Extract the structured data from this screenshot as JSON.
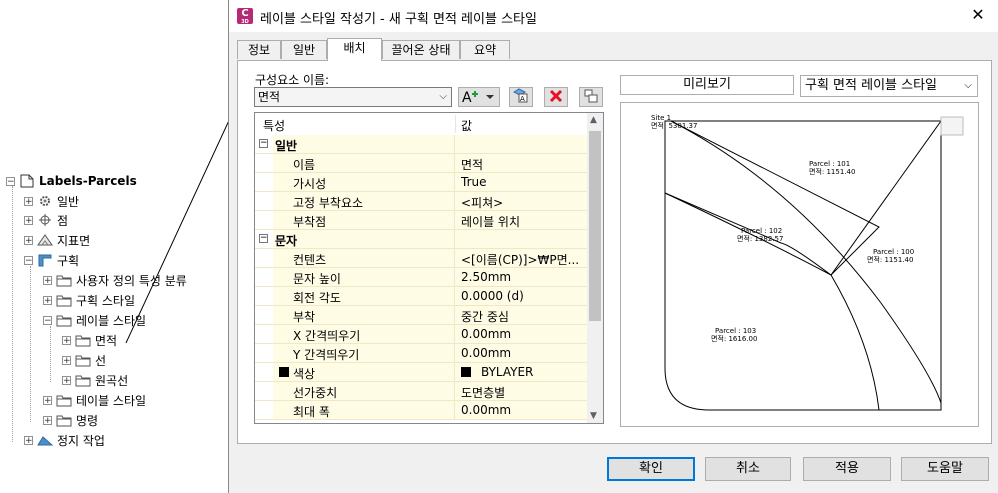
{
  "tree": {
    "root": "Labels-Parcels",
    "items": [
      {
        "label": "일반",
        "icon": "gear-icon"
      },
      {
        "label": "점",
        "icon": "point-icon"
      },
      {
        "label": "지표면",
        "icon": "surface-icon"
      },
      {
        "label": "구획",
        "icon": "parcel-icon"
      },
      {
        "label": "사용자 정의 특성 분류",
        "icon": "folder-icon"
      },
      {
        "label": "구획 스타일",
        "icon": "folder-icon"
      },
      {
        "label": "레이블 스타일",
        "icon": "folder-icon"
      },
      {
        "label": "면적",
        "icon": "folder-icon"
      },
      {
        "label": "선",
        "icon": "folder-icon"
      },
      {
        "label": "원곡선",
        "icon": "folder-icon"
      },
      {
        "label": "테이블 스타일",
        "icon": "folder-icon"
      },
      {
        "label": "명령",
        "icon": "folder-icon"
      },
      {
        "label": "정지 작업",
        "icon": "grading-icon"
      }
    ]
  },
  "dialog": {
    "title": "레이블 스타일 작성기 - 새 구획 면적 레이블 스타일",
    "app_icon_letter": "C",
    "app_icon_sub": "3D",
    "close_glyph": "✕",
    "tabs": [
      "정보",
      "일반",
      "배치",
      "끌어온 상태",
      "요약"
    ],
    "active_tab": 2
  },
  "layout_tab": {
    "component_label": "구성요소 이름:",
    "component_value": "면적",
    "grid_headers": {
      "property": "특성",
      "value": "값"
    },
    "rows": [
      {
        "type": "cat",
        "label": "일반"
      },
      {
        "label": "이름",
        "value": "면적"
      },
      {
        "label": "가시성",
        "value": "True"
      },
      {
        "label": "고정 부착요소",
        "value": "<피쳐>"
      },
      {
        "label": "부착점",
        "value": "레이블 위치"
      },
      {
        "type": "cat",
        "label": "문자"
      },
      {
        "label": "컨텐츠",
        "value": "<[이름(CP)]>₩P면..."
      },
      {
        "label": "문자 높이",
        "value": "2.50mm"
      },
      {
        "label": "회전 각도",
        "value": "0.0000 (d)"
      },
      {
        "label": "부착",
        "value": "중간 중심"
      },
      {
        "label": "X 간격띄우기",
        "value": "0.00mm"
      },
      {
        "label": "Y 간격띄우기",
        "value": "0.00mm"
      },
      {
        "label": "색상",
        "value": "BYLAYER",
        "swatch": true
      },
      {
        "label": "선가중치",
        "value": "도면층별"
      },
      {
        "label": "최대 폭",
        "value": "0.00mm"
      }
    ]
  },
  "preview": {
    "label": "미리보기",
    "style_value": "구획 면적 레이블 스타일",
    "site_name": "Site 1",
    "site_area": "면적: 5301.37",
    "parcels": [
      {
        "name": "Parcel : 101",
        "area": "면적: 1151.40"
      },
      {
        "name": "Parcel : 102",
        "area": "면적: 1382.57"
      },
      {
        "name": "Parcel : 100",
        "area": "면적: 1151.40"
      },
      {
        "name": "Parcel : 103",
        "area": "면적: 1616.00"
      }
    ]
  },
  "buttons": {
    "ok": "확인",
    "cancel": "취소",
    "apply": "적용",
    "help": "도움말"
  },
  "colors": {
    "accent": "#0078d7",
    "grid_bg": "#fffce6",
    "delete_red": "#e81123",
    "app_icon": "#b52a74"
  }
}
